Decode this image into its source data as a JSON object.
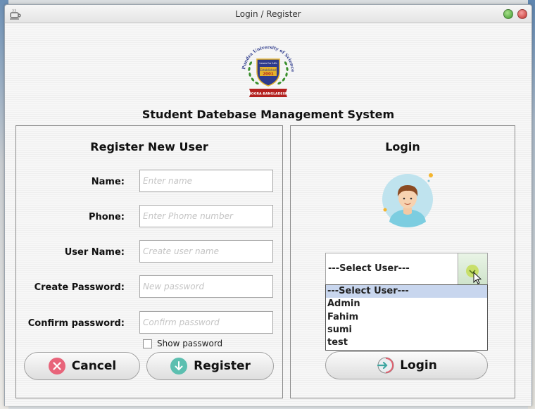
{
  "window": {
    "title": "Login / Register"
  },
  "app": {
    "heading": "Student Datebase Management System",
    "logo": {
      "icon": "university-seal-logo",
      "arc_text": "Pundra University of Science & Technology",
      "motto": "Learn for Life",
      "established_label": "Established",
      "established_year": "2001",
      "ribbon": "BOGRA-BANGLADESH"
    }
  },
  "register": {
    "title": "Register New User",
    "fields": [
      {
        "label": "Name:",
        "placeholder": "Enter name",
        "value": ""
      },
      {
        "label": "Phone:",
        "placeholder": "Enter Phome number",
        "value": ""
      },
      {
        "label": "User Name:",
        "placeholder": "Create user name",
        "value": ""
      },
      {
        "label": "Create Password:",
        "placeholder": "New password",
        "value": ""
      },
      {
        "label": "Confirm password:",
        "placeholder": "Confirm password",
        "value": ""
      }
    ],
    "show_password_label": "Show password",
    "show_password_checked": false,
    "cancel_label": "Cancel",
    "cancel_icon": "close-circle-icon",
    "register_label": "Register",
    "register_icon": "down-arrow-circle-icon"
  },
  "login": {
    "title": "Login",
    "avatar_icon": "user-avatar-icon",
    "select_value": "---Select User---",
    "options": [
      "---Select User---",
      "Admin",
      "Fahim",
      "sumi",
      "test"
    ],
    "selected_index": 0,
    "login_label": "Login",
    "login_icon": "login-arrow-icon"
  },
  "colors": {
    "cancel_icon": "#e8647a",
    "register_icon": "#5cbfb0",
    "dropdown_highlight": "#c8d6ee",
    "logo_blue": "#2e3b8c",
    "logo_gold": "#e3b22d"
  }
}
